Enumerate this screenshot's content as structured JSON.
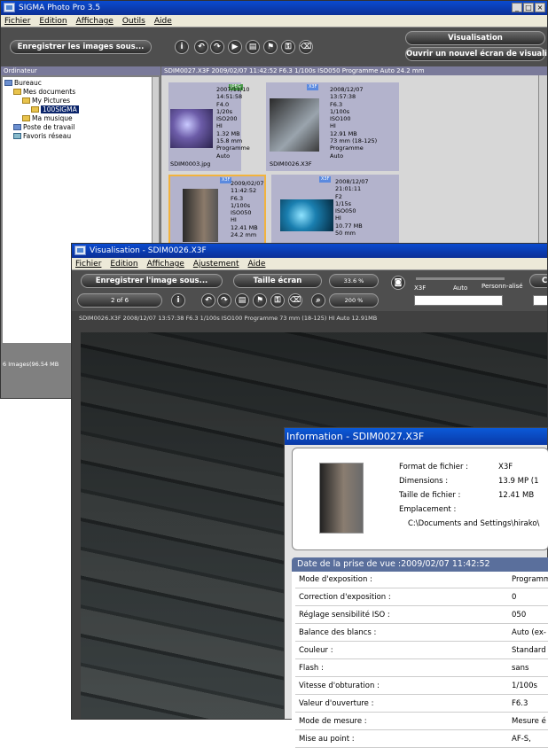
{
  "main_window": {
    "title": "SIGMA Photo Pro 3.5",
    "menu": [
      "Fichier",
      "Edition",
      "Affichage",
      "Outils",
      "Aide"
    ],
    "save_button": "Enregistrer les images sous...",
    "visualisation_button": "Visualisation",
    "open_view_button": "Ouvrir un nouvel écran de visualisation",
    "panel_header": "Ordinateur",
    "info_bar": "SDIM0027.X3F 2009/02/07 11:42:52 F6.3 1/100s ISO050 Programme Auto 24.2 mm",
    "tree": [
      {
        "label": "Bureauc",
        "depth": 0
      },
      {
        "label": "Mes documents",
        "depth": 1
      },
      {
        "label": "My Pictures",
        "depth": 2
      },
      {
        "label": "100SIGMA",
        "depth": 3
      },
      {
        "label": "Ma musique",
        "depth": 2
      },
      {
        "label": "Poste de travail",
        "depth": 1
      },
      {
        "label": "Favoris réseau",
        "depth": 1
      }
    ],
    "status": "6 Images(96.54 MB",
    "thumbnails": [
      {
        "tag": "JPEG",
        "file": "SDIM0003.jpg",
        "meta": [
          "2007/11/10",
          "14:51:58",
          "F4.0",
          "1/20s",
          "ISO200",
          "HI",
          "1.32 MB",
          "15.8 mm",
          "Programme",
          "Auto"
        ]
      },
      {
        "tag": "X3F",
        "file": "SDIM0026.X3F",
        "meta": [
          "2008/12/07",
          "13:57:38",
          "F6.3",
          "1/100s",
          "ISO100",
          "HI",
          "12.91 MB",
          "73 mm (18-125)",
          "Programme",
          "Auto"
        ]
      },
      {
        "tag": "X3F",
        "file": "",
        "meta": [
          "2009/02/07",
          "11:42:52",
          "F6.3",
          "1/100s",
          "ISO050",
          "HI",
          "12.41 MB",
          "24.2 mm"
        ]
      },
      {
        "tag": "X3F",
        "file": "",
        "meta": [
          "2008/12/07",
          "21:01:11",
          "F2",
          "1/15s",
          "ISO050",
          "HI",
          "10.77 MB",
          "50 mm"
        ]
      }
    ]
  },
  "view_window": {
    "title": "Visualisation - SDIM0026.X3F",
    "menu": [
      "Fichier",
      "Edition",
      "Affichage",
      "Ajustement",
      "Aide"
    ],
    "save_button": "Enregistrer l'image sous...",
    "fit_button": "Taille écran",
    "zoom1": "33.6 %",
    "zoom2": "200 %",
    "counter": "2 of 6",
    "mode_x3f": "X3F",
    "mode_auto": "Auto",
    "mode_custom": "Personn-alisé",
    "right_button": "Co",
    "info_line": "SDIM0026.X3F 2008/12/07 13:57:38 F6.3 1/100s ISO100 Programme 73 mm (18-125) HI Auto 12.91MB"
  },
  "info_window": {
    "title": "Information - SDIM0027.X3F",
    "format_label": "Format de fichier :",
    "format_value": "X3F",
    "dim_label": "Dimensions :",
    "dim_value": "13.9 MP (1",
    "size_label": "Taille de fichier :",
    "size_value": "12.41 MB",
    "location_label": "Emplacement :",
    "location_value": "C:\\Documents and Settings\\hirako\\",
    "date_header": "Date de la prise de vue :2009/02/07 11:42:52",
    "rows": [
      {
        "k": "Mode d'exposition :",
        "v": "Programm"
      },
      {
        "k": "Correction d'exposition :",
        "v": "0"
      },
      {
        "k": "Réglage sensibilité ISO :",
        "v": "050"
      },
      {
        "k": "Balance des blancs :",
        "v": "Auto (ex-"
      },
      {
        "k": "Couleur :",
        "v": "Standard"
      },
      {
        "k": "Flash :",
        "v": "sans"
      },
      {
        "k": "Vitesse d'obturation :",
        "v": "1/100s"
      },
      {
        "k": "Valeur d'ouverture :",
        "v": "F6.3"
      },
      {
        "k": "Mode de mesure :",
        "v": "Mesure é"
      },
      {
        "k": "Mise au point :",
        "v": "AF-S, "
      }
    ]
  },
  "colors": {
    "title_blue": "#0b3fb3",
    "info_header": "#5a6f9c",
    "selected": "#f2b33d"
  }
}
